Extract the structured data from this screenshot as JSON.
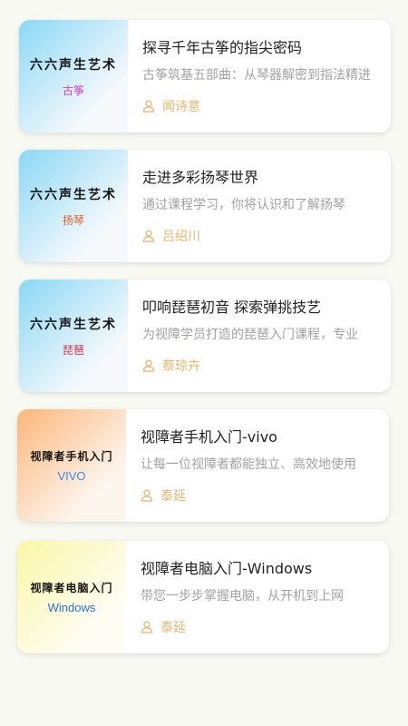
{
  "theme": {
    "page_bg": "#f9f9f3",
    "author_color": "#e7b56a",
    "title_color": "#222222",
    "desc_color": "#a2a2a2"
  },
  "courses": [
    {
      "thumb_title": "六六声生艺术",
      "thumb_sub": "古筝",
      "thumb_sub_color": "#d23cc6",
      "thumb_gradient": [
        "#8ad8f6",
        "#f6f9fc"
      ],
      "title": "探寻千年古筝的指尖密码",
      "desc": "古筝筑基五部曲：从琴器解密到指法精进",
      "author_icon": "person-icon",
      "author": "闻诗意"
    },
    {
      "thumb_title": "六六声生艺术",
      "thumb_sub": "扬琴",
      "thumb_sub_color": "#e0622a",
      "thumb_gradient": [
        "#8ad8f6",
        "#f6f9fc"
      ],
      "title": "走进多彩扬琴世界",
      "desc": "通过课程学习，你将认识和了解扬琴",
      "author_icon": "person-icon",
      "author": "吕绍川"
    },
    {
      "thumb_title": "六六声生艺术",
      "thumb_sub": "琵琶",
      "thumb_sub_color": "#e0344a",
      "thumb_gradient": [
        "#8ad8f6",
        "#f6f9fc"
      ],
      "title": "叩响琵琶初音 探索弹挑技艺",
      "desc": "为视障学员打造的琵琶入门课程，专业",
      "author_icon": "person-icon",
      "author": "蔡琼卉"
    },
    {
      "thumb_title": "视障者手机入门",
      "thumb_sub": "VIVO",
      "thumb_sub_color": "#3a8bf0",
      "thumb_gradient": [
        "#fbb67a",
        "#fdf6ef"
      ],
      "title": "视障者手机入门-vivo",
      "desc": "让每一位视障者都能独立、高效地使用",
      "author_icon": "person-icon",
      "author": "泰延"
    },
    {
      "thumb_title": "视障者电脑入门",
      "thumb_sub": "Windows",
      "thumb_sub_color": "#2a6fe0",
      "thumb_gradient": [
        "#fbf7a6",
        "#fdfdf4"
      ],
      "title": "视障者电脑入门-Windows",
      "desc": "带您一步步掌握电脑，从开机到上网",
      "author_icon": "person-icon",
      "author": "泰延"
    }
  ]
}
